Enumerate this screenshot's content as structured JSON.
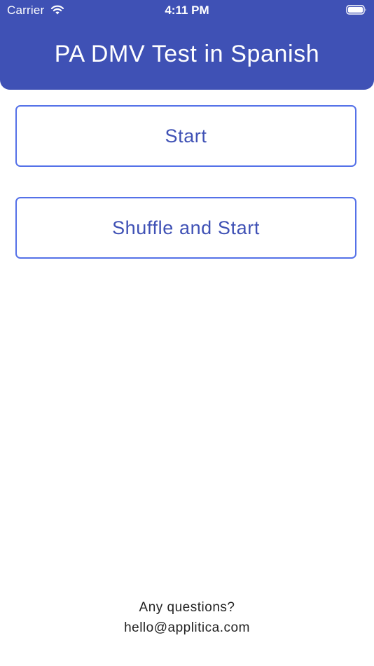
{
  "status_bar": {
    "carrier": "Carrier",
    "time": "4:11 PM",
    "wifi_icon": "wifi-icon",
    "battery_icon": "battery-icon"
  },
  "header": {
    "title": "PA DMV Test in Spanish",
    "background_color": "#3F51B5"
  },
  "actions": {
    "start_label": "Start",
    "shuffle_label": "Shuffle and Start",
    "border_color": "#5571E8",
    "text_color": "#3F51B5"
  },
  "footer": {
    "question": "Any questions?",
    "email": "hello@applitica.com"
  }
}
